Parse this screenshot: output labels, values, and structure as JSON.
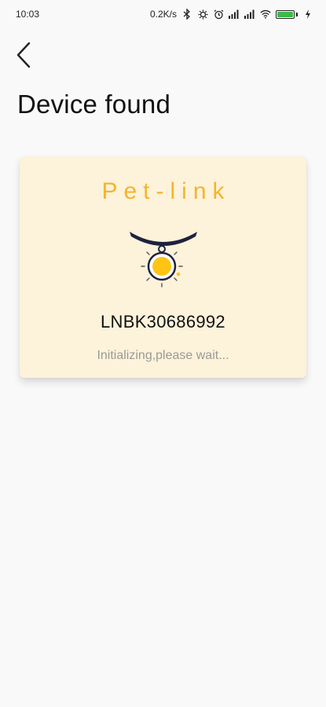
{
  "status_bar": {
    "time": "10:03",
    "net_speed": "0.2K/s",
    "icons": [
      "bluetooth-icon",
      "settings-icon",
      "alarm-icon",
      "signal-icon",
      "signal-icon",
      "wifi-icon",
      "battery-icon"
    ]
  },
  "header": {
    "back_icon": "chevron-left-icon",
    "title": "Device found"
  },
  "device_card": {
    "brand": "Pet-link",
    "device_id": "LNBK30686992",
    "status": "Initializing,please wait..."
  },
  "colors": {
    "brand": "#f3b52e",
    "card_background": "#fdf2da",
    "collar": "#1e2240",
    "tag": "#ffc414",
    "battery": "#3db84a"
  }
}
